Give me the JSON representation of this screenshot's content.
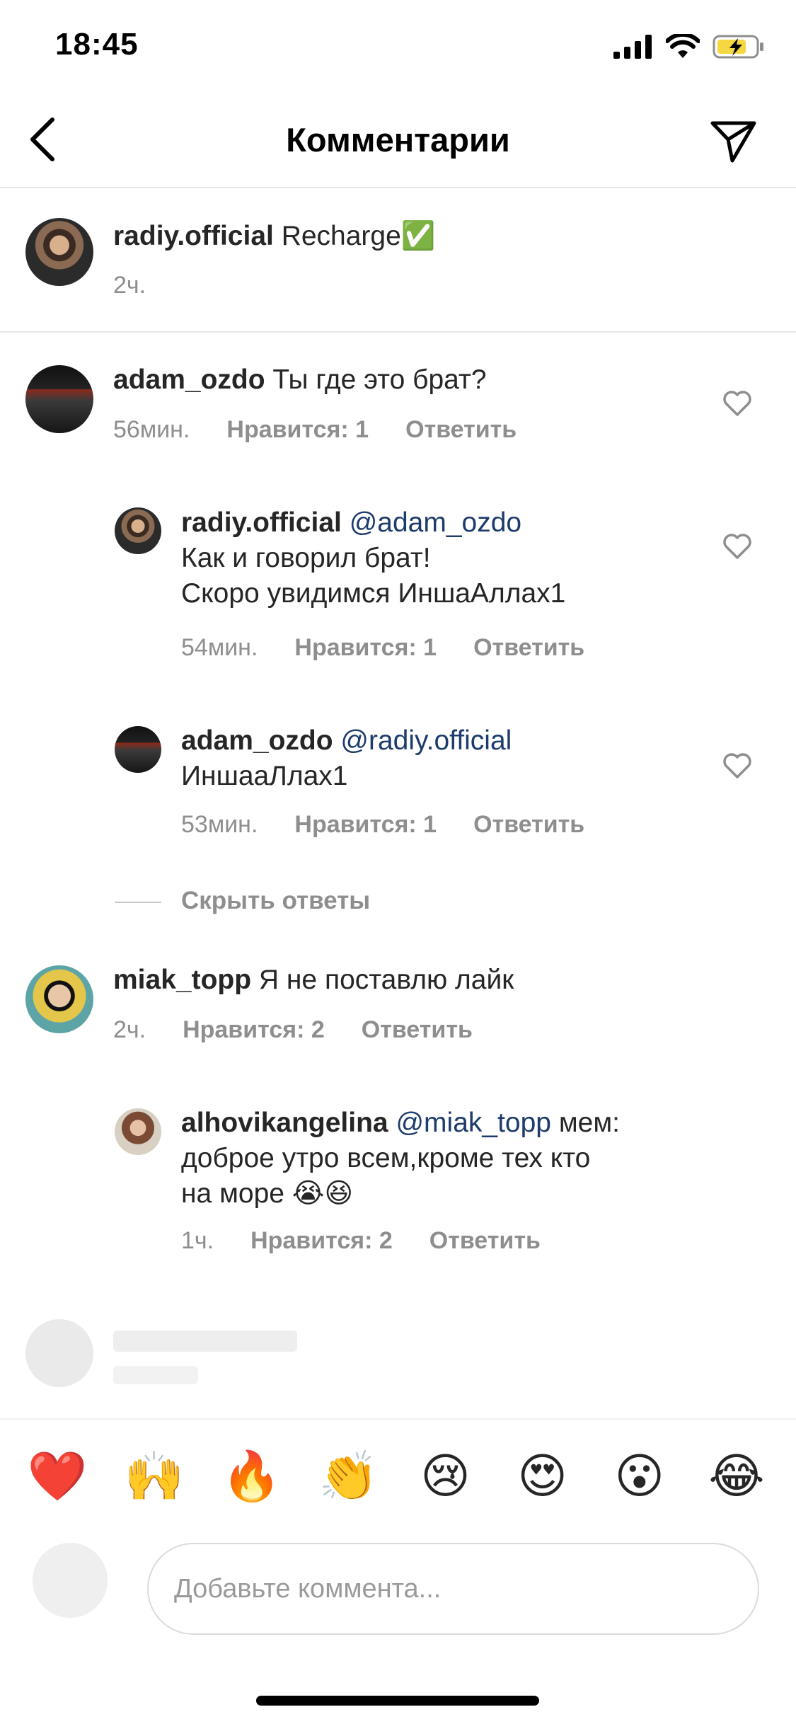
{
  "status_bar": {
    "time": "18:45"
  },
  "header": {
    "title": "Комментарии"
  },
  "post": {
    "username": "radiy.official",
    "caption": "Recharge✅",
    "time": "2ч."
  },
  "comments": [
    {
      "username": "adam_ozdo",
      "text": "Ты где это брат?",
      "time": "56мин.",
      "likes": "Нравится: 1",
      "reply": "Ответить"
    },
    {
      "username": "radiy.official",
      "mention": "@adam_ozdo",
      "line1": "Как и говорил брат!",
      "line2": "Скоро увидимся ИншаАллах1",
      "time": "54мин.",
      "likes": "Нравится: 1",
      "reply": "Ответить"
    },
    {
      "username": "adam_ozdo",
      "mention": "@radiy.official",
      "line1": "ИншааЛлах1",
      "time": "53мин.",
      "likes": "Нравится: 1",
      "reply": "Ответить"
    },
    {
      "username": "miak_topp",
      "text": "Я не поставлю лайк",
      "time": "2ч.",
      "likes": "Нравится: 2",
      "reply": "Ответить"
    },
    {
      "username": "alhovikangelina",
      "mention": "@miak_topp",
      "line1": "мем:",
      "line2": "доброе утро всем,кроме тех кто",
      "line3": "на море 😭😆",
      "time": "1ч.",
      "likes": "Нравится: 2",
      "reply": "Ответить"
    }
  ],
  "hide_replies": "Скрыть ответы",
  "emoji_bar": [
    "❤️",
    "🙌",
    "🔥",
    "👏",
    "😢",
    "😍",
    "😮",
    "😂"
  ],
  "input": {
    "placeholder": "Добавьте коммента..."
  },
  "icons": {
    "back": "chevron-left-icon",
    "send": "paper-plane-icon",
    "like": "heart-outline-icon"
  },
  "colors": {
    "mention": "#1d3b6b",
    "meta": "#8e8e8e",
    "battery_charge": "#f5d742"
  }
}
